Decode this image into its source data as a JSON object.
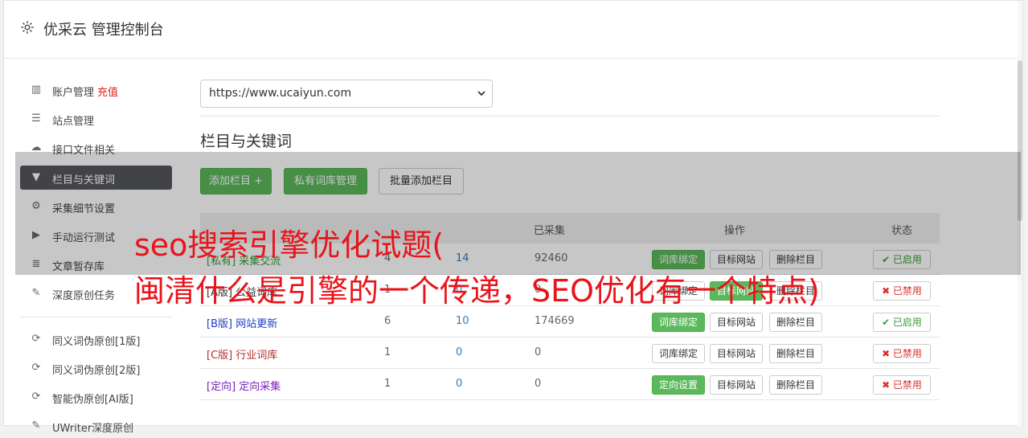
{
  "header": {
    "title": "优采云 管理控制台"
  },
  "sidebar": {
    "items": [
      {
        "label": "账户管理",
        "tag": "充值",
        "icon": "bar-chart-icon",
        "glyph": "▥"
      },
      {
        "label": "站点管理",
        "icon": "server-icon",
        "glyph": "☰"
      },
      {
        "label": "接口文件相关",
        "icon": "cloud-upload-icon",
        "glyph": "☁"
      },
      {
        "label": "栏目与关键词",
        "icon": "filter-icon",
        "glyph": "▼"
      },
      {
        "label": "采集细节设置",
        "icon": "cogs-icon",
        "glyph": "⚙"
      },
      {
        "label": "手动运行测试",
        "icon": "play-circle-icon",
        "glyph": "▶"
      },
      {
        "label": "文章暂存库",
        "icon": "database-icon",
        "glyph": "≣"
      },
      {
        "label": "深度原创任务",
        "icon": "edit-icon",
        "glyph": "✎"
      },
      {
        "label": "同义词伪原创[1版]",
        "icon": "refresh-icon",
        "glyph": "⟳"
      },
      {
        "label": "同义词伪原创[2版]",
        "icon": "refresh-icon",
        "glyph": "⟳"
      },
      {
        "label": "智能伪原创[AI版]",
        "icon": "refresh-icon",
        "glyph": "⟳"
      },
      {
        "label": "UWriter深度原创",
        "icon": "edit-icon",
        "glyph": "✎"
      }
    ]
  },
  "site_select": {
    "value": "https://www.ucaiyun.com"
  },
  "section": {
    "title": "栏目与关键词"
  },
  "toolbar": {
    "add_label": "添加栏目 +",
    "private_label": "私有词库管理",
    "batch_label": "批量添加栏目"
  },
  "table": {
    "headers": [
      "",
      "已采集",
      "操作",
      "状态"
    ],
    "rows": [
      {
        "name": "[私有] 采集交流",
        "c1": "4",
        "c2": "14",
        "c3": "92460",
        "b1": "词库绑定",
        "b2": "目标网站",
        "b3": "删除栏目",
        "status": "✔ 已启用",
        "name_color": "#3c9a3c",
        "b1_green": true,
        "on": true
      },
      {
        "name": "[A版] 公益词库",
        "c1": "1",
        "c2": "0",
        "c3": "0",
        "b1": "词库绑定",
        "b2": "目标网站",
        "b3": "删除栏目",
        "status": "✖ 已禁用",
        "name_color": "#333333",
        "b1_green": false,
        "b2_green": true,
        "on": false
      },
      {
        "name": "[B版] 网站更新",
        "c1": "6",
        "c2": "10",
        "c3": "174669",
        "b1": "词库绑定",
        "b2": "目标网站",
        "b3": "删除栏目",
        "status": "✔ 已启用",
        "name_color": "#1a3fc4",
        "b1_green": true,
        "on": true
      },
      {
        "name": "[C版] 行业词库",
        "c1": "1",
        "c2": "0",
        "c3": "0",
        "b1": "词库绑定",
        "b2": "目标网站",
        "b3": "删除栏目",
        "status": "✖ 已禁用",
        "name_color": "#b03030",
        "b1_green": false,
        "on": false
      },
      {
        "name": "[定向] 定向采集",
        "c1": "1",
        "c2": "0",
        "c3": "0",
        "b1": "定向设置",
        "b2": "目标网站",
        "b3": "删除栏目",
        "status": "✖ 已禁用",
        "name_color": "#7a22b8",
        "b1_green": true,
        "on": false
      }
    ]
  },
  "overlay": {
    "line1": "seo搜索引擎优化试题(",
    "line2": "闽清什么是引擎的一个传递，SEO优化有一个特点)"
  }
}
